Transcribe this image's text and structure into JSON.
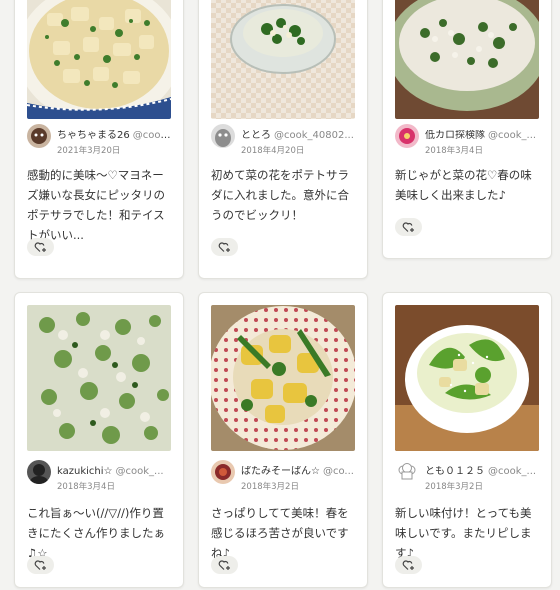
{
  "cards": [
    {
      "user": "ちゃちゃまる26",
      "handle": "@cook_...",
      "date": "2021年3月20日",
      "comment": "感動的に美味～♡マヨネーズ嫌いな長女にピッタリのポテサラでした！和テイストがいい...",
      "avatar_color": "#5a3a2a",
      "photo_icon": "potato-salad-photo"
    },
    {
      "user": "ととろ",
      "handle": "@cook_40802...",
      "date": "2018年4月20日",
      "comment": "初めて菜の花をポテトサラダに入れました。意外に合うのでビックリ！",
      "avatar_color": "#9a9a9a",
      "photo_icon": "glass-bowl-salad-photo"
    },
    {
      "user": "低カロ探検隊",
      "handle": "@cook_...",
      "date": "2018年3月4日",
      "comment": "新じゃがと菜の花♡春の味美味しく出来ました♪",
      "avatar_color": "#d8326a",
      "photo_icon": "green-plate-salad-photo"
    },
    {
      "user": "kazukichi☆",
      "handle": "@cook_...",
      "date": "2018年3月4日",
      "comment": "これ旨ぁ～い(//▽//)作り置きにたくさん作りましたぁ♫☆",
      "avatar_color": "#333333",
      "photo_icon": "mashed-salad-photo"
    },
    {
      "user": "ぱたみそーぱん☆",
      "handle": "@co...",
      "date": "2018年3月2日",
      "comment": "さっぱりしてて美味！春を感じるほろ苦さが良いですね♪",
      "avatar_color": "#8a2a2a",
      "photo_icon": "dotted-plate-potato-photo"
    },
    {
      "user": "とも０１２５",
      "handle": "@cook_...",
      "date": "2018年3月2日",
      "comment": "新しい味付け！とっても美味しいです。またリピします♪",
      "avatar_color": "#ffffff",
      "photo_icon": "white-bowl-salad-photo"
    }
  ]
}
